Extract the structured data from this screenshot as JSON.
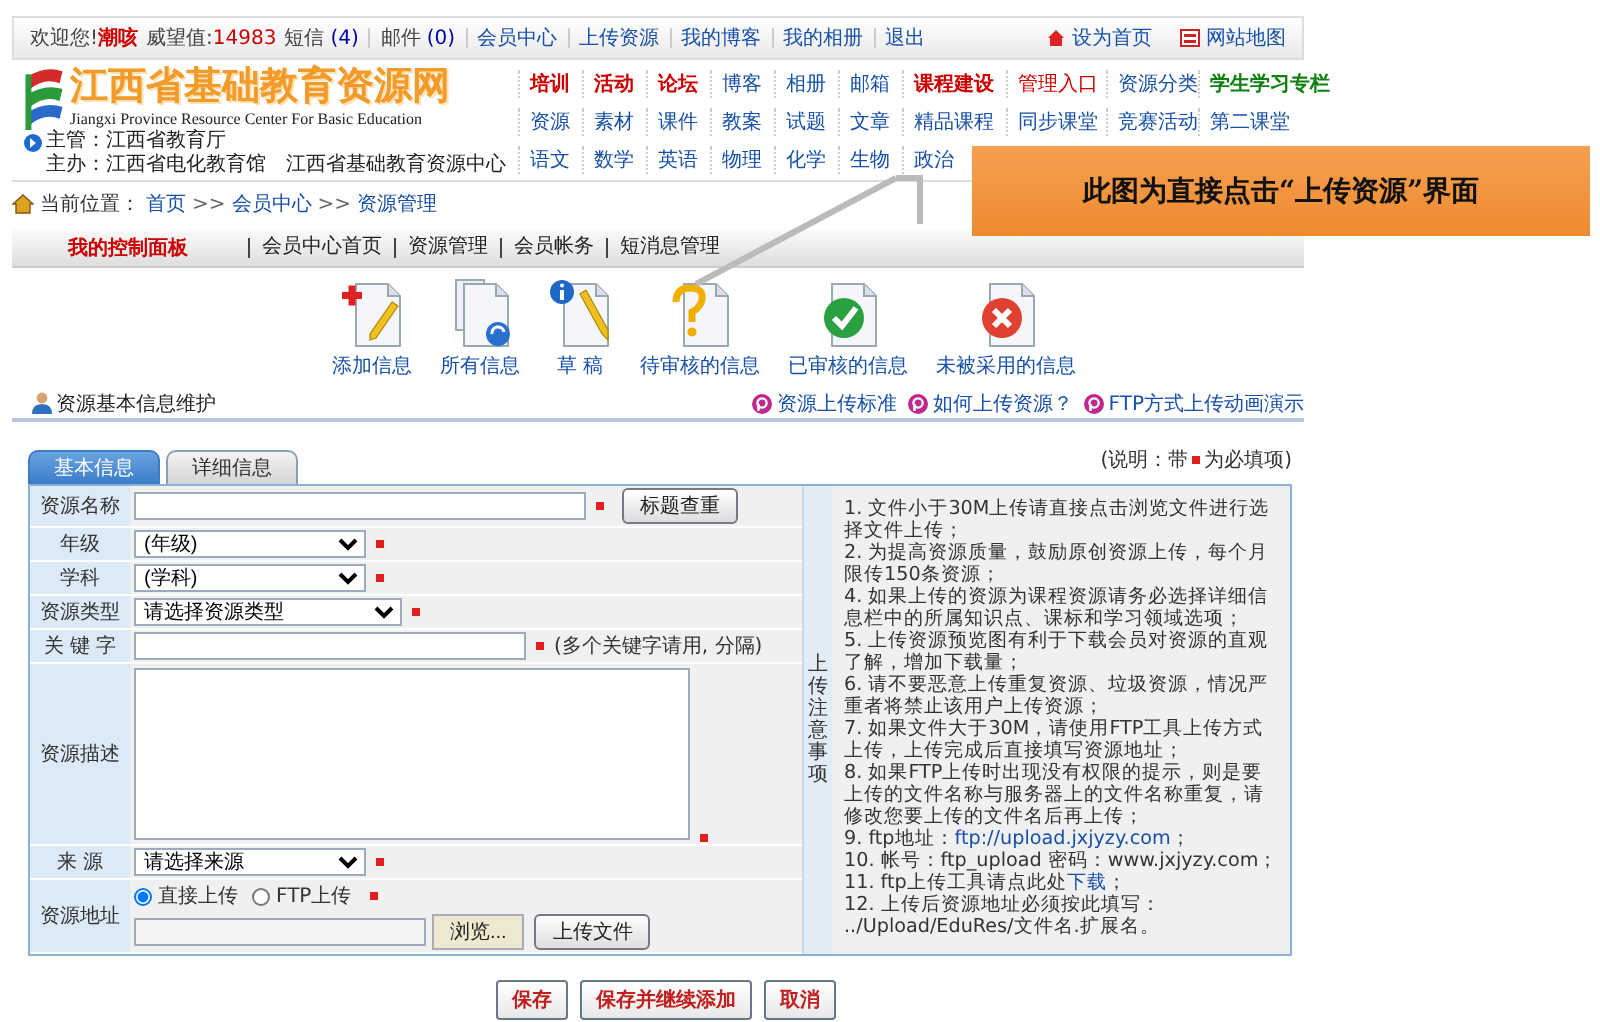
{
  "top_bar": {
    "welcome": "欢迎您!",
    "username": "潮咳",
    "reputation_label": "威望值:",
    "reputation": "14983",
    "counters": [
      {
        "label": "短信",
        "count": "(4)"
      },
      {
        "label": "邮件",
        "count": "(0)"
      }
    ],
    "links": [
      "会员中心",
      "上传资源",
      "我的博客",
      "我的相册",
      "退出"
    ],
    "right_links": [
      {
        "kind": "home",
        "label": "设为首页"
      },
      {
        "kind": "sitemap",
        "label": "网站地图"
      }
    ]
  },
  "header": {
    "site_title": "江西省基础教育资源网",
    "site_subtitle": "Jiangxi Province Resource Center For Basic Education",
    "sponsor_lines": [
      "主管：江西省教育厅",
      "主办：江西省电化教育馆",
      "江西省基础教育资源中心"
    ],
    "nav_rows": [
      [
        {
          "text": "培训",
          "color": "#cc0000",
          "bold": true
        },
        {
          "text": "活动",
          "color": "#cc0000",
          "bold": true
        },
        {
          "text": "论坛",
          "color": "#cc0000",
          "bold": true
        },
        {
          "text": "博客",
          "color": "#1650a8",
          "bold": false
        },
        {
          "text": "相册",
          "color": "#1650a8",
          "bold": false
        },
        {
          "text": "邮箱",
          "color": "#1650a8",
          "bold": false
        },
        {
          "text": "课程建设",
          "color": "#cc0000",
          "bold": true
        },
        {
          "text": "管理入口",
          "color": "#cc0000",
          "bold": false
        },
        {
          "text": "资源分类",
          "color": "#1650a8",
          "bold": false
        },
        {
          "text": "学生学习专栏",
          "color": "#108010",
          "bold": true
        }
      ],
      [
        {
          "text": "资源",
          "color": "#1650a8",
          "bold": false
        },
        {
          "text": "素材",
          "color": "#1650a8",
          "bold": false
        },
        {
          "text": "课件",
          "color": "#1650a8",
          "bold": false
        },
        {
          "text": "教案",
          "color": "#1650a8",
          "bold": false
        },
        {
          "text": "试题",
          "color": "#1650a8",
          "bold": false
        },
        {
          "text": "文章",
          "color": "#1650a8",
          "bold": false
        },
        {
          "text": "精品课程",
          "color": "#1650a8",
          "bold": false
        },
        {
          "text": "同步课堂",
          "color": "#1650a8",
          "bold": false
        },
        {
          "text": "竞赛活动",
          "color": "#1650a8",
          "bold": false
        },
        {
          "text": "第二课堂",
          "color": "#1650a8",
          "bold": false
        }
      ],
      [
        {
          "text": "语文",
          "color": "#1650a8",
          "bold": false
        },
        {
          "text": "数学",
          "color": "#1650a8",
          "bold": false
        },
        {
          "text": "英语",
          "color": "#1650a8",
          "bold": false
        },
        {
          "text": "物理",
          "color": "#1650a8",
          "bold": false
        },
        {
          "text": "化学",
          "color": "#1650a8",
          "bold": false
        },
        {
          "text": "生物",
          "color": "#1650a8",
          "bold": false
        },
        {
          "text": "政治",
          "color": "#1650a8",
          "bold": false
        }
      ]
    ]
  },
  "breadcrumb": {
    "label": "当前位置：",
    "items": [
      "首页",
      "会员中心",
      "资源管理"
    ],
    "separators": [
      ">>",
      ">>"
    ]
  },
  "control_panel": {
    "title": "我的控制面板",
    "menu": [
      "会员中心首页",
      "资源管理",
      "会员帐务",
      "短消息管理"
    ]
  },
  "toolbar": [
    {
      "kind": "add",
      "label": "添加信息"
    },
    {
      "kind": "all",
      "label": "所有信息"
    },
    {
      "kind": "draft",
      "label": "草 稿"
    },
    {
      "kind": "pending",
      "label": "待审核的信息"
    },
    {
      "kind": "approved",
      "label": "已审核的信息"
    },
    {
      "kind": "rejected",
      "label": "未被采用的信息"
    }
  ],
  "section": {
    "title": "资源基本信息维护",
    "help_links": [
      "资源上传标准",
      "如何上传资源？",
      "FTP方式上传动画演示"
    ]
  },
  "form": {
    "tabs": [
      {
        "label": "基本信息",
        "selected": true
      },
      {
        "label": "详细信息",
        "selected": false
      }
    ],
    "note_before": "(说明：带",
    "note_after": "为必填项)",
    "rows": [
      {
        "kind": "text",
        "label": "资源名称",
        "required": true,
        "button": "标题查重"
      },
      {
        "kind": "select",
        "label": "年级",
        "value": "(年级)",
        "required": true
      },
      {
        "kind": "select",
        "label": "学科",
        "value": "(学科)",
        "required": true
      },
      {
        "kind": "select",
        "label": "资源类型",
        "value": "请选择资源类型",
        "required": true
      },
      {
        "kind": "text",
        "label": "关 键 字",
        "required": true,
        "hint": "(多个关键字请用, 分隔)"
      },
      {
        "kind": "textarea",
        "label": "资源描述",
        "required": true
      },
      {
        "kind": "select",
        "label": "来 源",
        "value": "请选择来源",
        "required": true
      },
      {
        "kind": "upload",
        "label": "资源地址",
        "required": true,
        "options": [
          {
            "label": "直接上传",
            "selected": true
          },
          {
            "label": "FTP上传",
            "selected": false
          }
        ],
        "browse": "浏览...",
        "button": "上传文件"
      }
    ],
    "notes_title": "上传注意事项",
    "notes": [
      {
        "text": "1. 文件小于30M上传请直接点击浏览文件进行选择文件上传；"
      },
      {
        "text": "2. 为提高资源质量，鼓励原创资源上传，每个月限传150条资源；"
      },
      {
        "text": "4. 如果上传的资源为课程资源请务必选择详细信息栏中的所属知识点、课标和学习领域选项；"
      },
      {
        "text": "5. 上传资源预览图有利于下载会员对资源的直观了解，增加下载量；"
      },
      {
        "text": "6. 请不要恶意上传重复资源、垃圾资源，情况严重者将禁止该用户上传资源；"
      },
      {
        "text": "7. 如果文件大于30M，请使用FTP工具上传方式上传，上传完成后直接填写资源地址；"
      },
      {
        "text": "8. 如果FTP上传时出现没有权限的提示，则是要上传的文件名称与服务器上的文件名称重复，请修改您要上传的文件名后再上传；"
      },
      {
        "text": "9. ftp地址：",
        "link": "ftp://upload.jxjyzy.com",
        "tail": "；"
      },
      {
        "text": "10. 帐号：ftp_upload 密码：www.jxjyzy.com；"
      },
      {
        "text": "11. ftp上传工具请点此处",
        "link": "下载",
        "tail": "；"
      },
      {
        "text": "12. 上传后资源地址必须按此填写： ../Upload/EduRes/文件名.扩展名。"
      }
    ]
  },
  "buttons": [
    "保存",
    "保存并继续添加",
    "取消"
  ],
  "callout": {
    "text": "此图为直接点击“上传资源”界面"
  }
}
